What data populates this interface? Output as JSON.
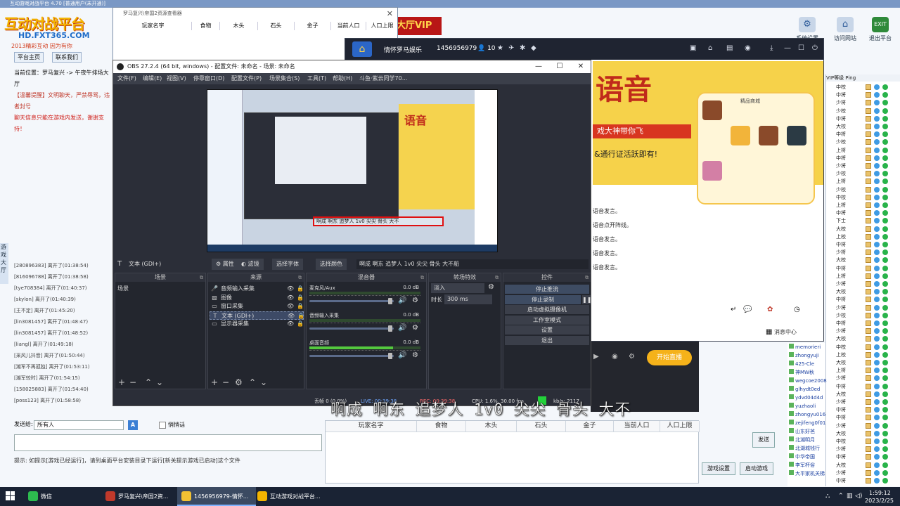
{
  "bg_app": {
    "title": "互动游戏对战平台 4.70 [普通用户(未开通)]",
    "logo_line1": "互动对战平台",
    "logo_line2": "HD.FXT365.COM",
    "logo_line3": "2013精彩互动 因为有你",
    "vip": "大厅VIP",
    "top_icons": [
      {
        "label": "系统设置",
        "icon": "gear-icon"
      },
      {
        "label": "访问网站",
        "icon": "house-icon"
      },
      {
        "label": "退出平台",
        "icon": "exit-icon",
        "tag": "EXIT"
      }
    ],
    "tabs": [
      "平台主页",
      "联系我们"
    ],
    "lines": [
      "当前位置：罗马复兴 -> 午夜牛排场大厅",
      "【温馨提醒】文明聊天，严禁辱骂，违者封号",
      "聊天信息只能在游戏内发送，谢谢支持！"
    ],
    "chat_lines": [
      "[280896383] 离开了(01:38:54)",
      "[816096788] 离开了(01:38:58)",
      "[tye708384] 离开了(01:40:37)",
      "[skylon] 离开了(01:40:39)",
      "[王不定] 离开了(01:45:20)",
      "[lin3081457] 离开了(01:48:47)",
      "[lin3081457] 离开了(01:48:52)",
      "[liangl] 离开了(01:49:18)",
      "[采风儿抖音] 离开了(01:50:44)",
      "[潮军不再孤独] 离开了(01:53:11)",
      "[潮军较时] 离开了(01:54:15)",
      "[158025883] 离开了(01:54:40)",
      "[poss123] 离开了(01:58:58)"
    ],
    "send_label": "发送给:",
    "send_target": "所有人",
    "private_label": "悄悄话",
    "hint": "提示: 如提示[游戏已经运行]，请到桌面平台安装目录下运行[新关提示游戏已启动]这个文件",
    "side_left": "游戏大厅",
    "player_table_headers": [
      "玩家名字",
      "食物",
      "木头",
      "石头",
      "金子",
      "当前人口",
      "人口上限"
    ],
    "btn_send": "发送",
    "btn_game_settings": "游戏设置",
    "btn_start_game": "启动游戏",
    "userlist_header": "VIP等级  Ping",
    "userlist_rows": [
      "中校",
      "中将",
      "少将",
      "少校",
      "中将",
      "大校",
      "中将",
      "少校",
      "上将",
      "中将",
      "少将",
      "少校",
      "上将",
      "少校",
      "中校",
      "上将",
      "中将",
      "下士",
      "大校",
      "上校",
      "中将",
      "少将",
      "大校",
      "中将",
      "上将",
      "少将",
      "大校",
      "中将",
      "少将",
      "少校",
      "中将",
      "少将",
      "大校",
      "中校",
      "上校",
      "大校",
      "上将",
      "少将",
      "中将",
      "大校",
      "少将",
      "中将",
      "中将",
      "少将",
      "大校",
      "中校",
      "少将",
      "中将",
      "大校",
      "少将",
      "中将"
    ],
    "userlist2": [
      "memorieri",
      "zhongyuji",
      "425-Cle",
      "神MW秋",
      "wegcoe2008",
      "glhydt0ed",
      "ydvd04d4d",
      "yuzhaoli",
      "zhongyu016",
      "zejifeng0f01",
      "山东好爸",
      "北湖明月",
      "北湖城钱行",
      "中华帝国",
      "李军杯俗",
      "大平家机关梯"
    ]
  },
  "dlg_back": {
    "title": "罗马复兴\\帝国2资源查看器",
    "headers": [
      "玩家名字",
      "食物",
      "木头",
      "石头",
      "金子",
      "当前人口",
      "人口上限"
    ]
  },
  "voice": {
    "room_name": "情怀罗马娱乐",
    "room_id": "1456956979",
    "online": "10",
    "banner_big": "语音",
    "banner_sub1": "戏大神带你飞",
    "banner_sub2": "&通行证活跃即有!",
    "phone_title": "精品商城",
    "lines": [
      "语音发言。",
      "语音点开阵线。",
      "语音发言。",
      "语音发言。",
      "语音发言。"
    ],
    "msg_center": "消息中心",
    "live_btn": "开始直播"
  },
  "obs": {
    "title": "OBS 27.2.4 (64 bit, windows) - 配置文件: 未命名 - 场景: 未命名",
    "menu": [
      "文件(F)",
      "编辑(E)",
      "视图(V)",
      "停靠窗口(D)",
      "配置文件(P)",
      "场景集合(S)",
      "工具(T)",
      "帮助(H)",
      "斗鱼·紫云同学70..."
    ],
    "preview_overlay": "啊成 啊东 追梦人 1v0 尖尖 骨头 大不",
    "src_selected_label": "文本 (GDI+)",
    "btn_properties": "属性",
    "btn_filters": "滤镜",
    "btn_select_font": "选择字体",
    "btn_select_color": "选择颜色",
    "text_value": "啊成 啊东 追梦人 1v0 尖尖 骨头 大不船",
    "dock_scenes": "场景",
    "dock_sources": "来源",
    "dock_mixer": "混音器",
    "dock_transitions": "转场特效",
    "dock_controls": "控件",
    "scenes": [
      "场景"
    ],
    "sources": [
      {
        "icon": "mic-icon",
        "label": "音频输入采集"
      },
      {
        "icon": "image-icon",
        "label": "图像"
      },
      {
        "icon": "window-icon",
        "label": "窗口采集"
      },
      {
        "icon": "text-icon",
        "label": "文本 (GDI+)"
      },
      {
        "icon": "monitor-icon",
        "label": "显示器采集"
      }
    ],
    "mixer": [
      {
        "name": "麦克风/Aux",
        "db": "0.0 dB",
        "level": 0.0
      },
      {
        "name": "音频输入采集",
        "db": "0.0 dB",
        "level": 0.0
      },
      {
        "name": "桌面音频",
        "db": "0.0 dB",
        "level": 0.75
      }
    ],
    "transition": "淡入",
    "duration_label": "时长",
    "duration": "300 ms",
    "controls": [
      "停止推流",
      "停止录制",
      "启动虚拟摄像机",
      "工作室模式",
      "设置",
      "退出"
    ],
    "status": {
      "dropped": "丢帧 0 (0.0%)",
      "live": "LIVE: 00:39:38",
      "rec": "REC: 00:39:38",
      "cpu": "CPU: 1.6%, 30.00 fps",
      "kbps": "kb/s: 2117"
    }
  },
  "overlay_text": "啊成 啊东 追梦人 1v0 尖尖 骨头 大不",
  "taskbar": {
    "items": [
      {
        "label": "微信",
        "color": "#2dbb4f"
      },
      {
        "label": "罗马复兴\\帝国2资...",
        "color": "#c0392b"
      },
      {
        "label": "1456956979-情怀...",
        "color": "#f2c233"
      },
      {
        "label": "互动游戏对战平台...",
        "color": "#f3b400"
      }
    ],
    "time": "1:59:12",
    "date": "2023/2/25"
  },
  "colors": {
    "obs_bg": "#2b2e38",
    "accent": "#f5b21a",
    "live_green": "#23d13a"
  }
}
